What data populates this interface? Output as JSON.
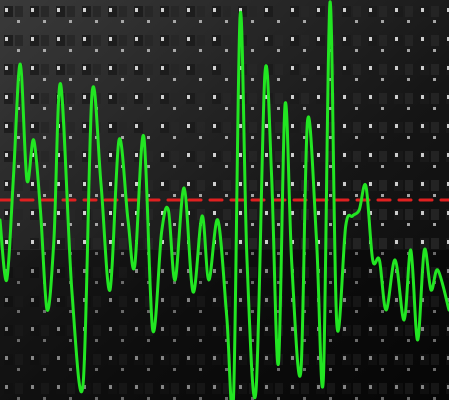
{
  "chart_data": {
    "type": "line",
    "title": "",
    "xlabel": "",
    "ylabel": "",
    "grid": false,
    "legend": "none",
    "xlim": [
      0,
      100
    ],
    "ylim": [
      -1,
      1
    ],
    "series": [
      {
        "color": "#22e622",
        "style": "solid",
        "x": [
          0,
          1.5,
          3,
          4.5,
          6,
          7.5,
          9,
          10.5,
          12,
          13.5,
          16,
          18.5,
          20.5,
          22.5,
          24.5,
          26.5,
          28.5,
          30,
          32,
          34,
          36,
          37.5,
          39,
          41,
          43,
          45,
          46.5,
          48.5,
          50.5,
          52,
          53.5,
          55,
          57,
          59,
          60.5,
          62,
          63.5,
          65,
          67,
          68.5,
          70.5,
          72,
          73.5,
          75,
          77,
          78.5,
          80,
          81.5,
          83,
          84.5,
          86,
          88,
          90,
          91.5,
          93,
          94.5,
          96,
          97.5,
          100
        ],
        "y": [
          -0.1,
          -0.4,
          0.12,
          0.68,
          0.1,
          0.3,
          -0.05,
          -0.55,
          -0.2,
          0.58,
          -0.45,
          -0.92,
          0.53,
          0.08,
          -0.45,
          0.3,
          -0.1,
          -0.33,
          0.32,
          -0.65,
          -0.16,
          -0.05,
          -0.4,
          0.06,
          -0.46,
          -0.08,
          -0.4,
          -0.1,
          -0.58,
          -0.99,
          0.93,
          -0.3,
          -0.96,
          0.63,
          0.12,
          -0.82,
          0.48,
          -0.33,
          -0.86,
          0.4,
          -0.2,
          -0.9,
          0.99,
          -0.62,
          -0.13,
          -0.08,
          -0.05,
          0.07,
          -0.3,
          -0.3,
          -0.55,
          -0.3,
          -0.6,
          -0.25,
          -0.7,
          -0.25,
          -0.45,
          -0.35,
          -0.55
        ]
      },
      {
        "color": "#e02020",
        "style": "dashed",
        "x": [
          0,
          100
        ],
        "y": [
          0,
          0
        ]
      }
    ]
  }
}
